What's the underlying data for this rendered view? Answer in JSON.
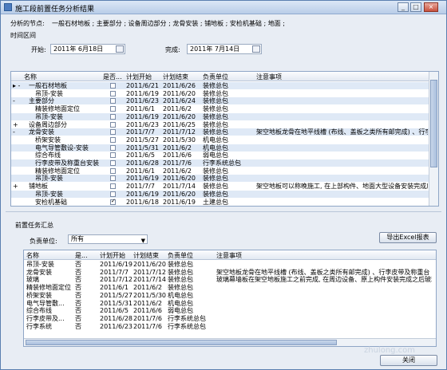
{
  "window": {
    "title": "施工段前置任务分析结果",
    "min": "_",
    "max": "□",
    "close": "×"
  },
  "nodes": {
    "label": "分析的节点:",
    "text": "一般石材地板 ; 主要部分 ; 设备周边部分 ; 龙骨安装 ; 铺地板 ; 安检机基础 ; 地面 ;"
  },
  "interval": {
    "label": "时间区间",
    "start_label": "开始:",
    "start_value": "2011年 6月18日",
    "end_label": "完成:",
    "end_value": "2011年 7月14日"
  },
  "grid": {
    "columns": [
      "名称",
      "是否...",
      "计划开始",
      "计划结束",
      "负责单位",
      "注意事项"
    ],
    "rows": [
      {
        "exp": "▸ -",
        "name": "一般石材地板",
        "chk": false,
        "start": "2011/6/21",
        "end": "2011/6/26",
        "unit": "装修总包",
        "note": ""
      },
      {
        "exp": "",
        "name": "吊顶-安装",
        "chk": false,
        "start": "2011/6/19",
        "end": "2011/6/20",
        "unit": "装修总包",
        "note": ""
      },
      {
        "exp": "-",
        "name": "主要部分",
        "chk": false,
        "start": "2011/6/23",
        "end": "2011/6/24",
        "unit": "装修总包",
        "note": ""
      },
      {
        "exp": "",
        "name": "精装修地面定位",
        "chk": false,
        "start": "2011/6/1",
        "end": "2011/6/2",
        "unit": "装修总包",
        "note": ""
      },
      {
        "exp": "",
        "name": "吊顶-安装",
        "chk": false,
        "start": "2011/6/19",
        "end": "2011/6/20",
        "unit": "装修总包",
        "note": ""
      },
      {
        "exp": "+",
        "name": "设备周边部分",
        "chk": false,
        "start": "2011/6/23",
        "end": "2011/6/25",
        "unit": "装修总包",
        "note": ""
      },
      {
        "exp": "-",
        "name": "龙骨安装",
        "chk": false,
        "start": "2011/7/7",
        "end": "2011/7/12",
        "unit": "装修总包",
        "note": "架空地板龙骨在地平线槽 (布线、盖板之类所有邮完成) 、行李皮"
      },
      {
        "exp": "",
        "name": "桥架安装",
        "chk": false,
        "start": "2011/5/27",
        "end": "2011/5/30",
        "unit": "机电总包",
        "note": ""
      },
      {
        "exp": "",
        "name": "电气导管敷设-安装",
        "chk": false,
        "start": "2011/5/31",
        "end": "2011/6/2",
        "unit": "机电总包",
        "note": ""
      },
      {
        "exp": "",
        "name": "综合布线",
        "chk": false,
        "start": "2011/6/5",
        "end": "2011/6/6",
        "unit": "弱电总包",
        "note": ""
      },
      {
        "exp": "",
        "name": "行李皮带及称重台安装",
        "chk": false,
        "start": "2011/6/28",
        "end": "2011/7/6",
        "unit": "行李系统总包",
        "note": ""
      },
      {
        "exp": "",
        "name": "精装修地面定位",
        "chk": false,
        "start": "2011/6/1",
        "end": "2011/6/2",
        "unit": "装修总包",
        "note": ""
      },
      {
        "exp": "",
        "name": "吊顶-安装",
        "chk": false,
        "start": "2011/6/19",
        "end": "2011/6/20",
        "unit": "装修总包",
        "note": ""
      },
      {
        "exp": "+",
        "name": "铺地板",
        "chk": false,
        "start": "2011/7/7",
        "end": "2011/7/14",
        "unit": "装修总包",
        "note": "架空地板可以称晚施工, 在上部构件、地面大型设备安装完成后安"
      },
      {
        "exp": "",
        "name": "吊顶-安装",
        "chk": false,
        "start": "2011/6/19",
        "end": "2011/6/20",
        "unit": "装修总包",
        "note": ""
      },
      {
        "exp": "",
        "name": "安检机基础",
        "chk": true,
        "start": "2011/6/18",
        "end": "2011/6/19",
        "unit": "土建总包",
        "note": ""
      }
    ]
  },
  "summary": {
    "title": "前置任务汇总",
    "unit_label": "负责单位:",
    "unit_value": "所有",
    "export_label": "导出Excel报表",
    "columns": [
      "名称",
      "是...",
      "计划开始",
      "计划结束",
      "负责单位",
      "注意事项"
    ],
    "rows": [
      {
        "name": "吊顶-安装",
        "flag": "否",
        "start": "2011/6/19",
        "end": "2011/6/20",
        "unit": "装修总包",
        "note": ""
      },
      {
        "name": "龙骨安装",
        "flag": "否",
        "start": "2011/7/7",
        "end": "2011/7/12",
        "unit": "装修总包",
        "note": "架空地板龙骨在地平线槽 (布线、盖板之类所有邮完成) 、行李皮带及称重台"
      },
      {
        "name": "玻璃",
        "flag": "否",
        "start": "2011/7/12",
        "end": "2011/7/14",
        "unit": "装修总包",
        "note": "玻璃幕墙板在架空地板施工之前完成, 在周边设备、原上构件安装完成之后玻璃板安"
      },
      {
        "name": "精装修地面定位",
        "flag": "否",
        "start": "2011/6/1",
        "end": "2011/6/2",
        "unit": "装修总包",
        "note": ""
      },
      {
        "name": "桥架安装",
        "flag": "否",
        "start": "2011/5/27",
        "end": "2011/5/30",
        "unit": "机电总包",
        "note": ""
      },
      {
        "name": "电气导管敷...",
        "flag": "否",
        "start": "2011/5/31",
        "end": "2011/6/2",
        "unit": "机电总包",
        "note": ""
      },
      {
        "name": "综合布线",
        "flag": "否",
        "start": "2011/6/5",
        "end": "2011/6/6",
        "unit": "弱电总包",
        "note": ""
      },
      {
        "name": "行李皮带及...",
        "flag": "否",
        "start": "2011/6/28",
        "end": "2011/7/6",
        "unit": "行李系统总包",
        "note": ""
      },
      {
        "name": "行李系统",
        "flag": "否",
        "start": "2011/6/23",
        "end": "2011/7/6",
        "unit": "行李系统总包",
        "note": ""
      }
    ]
  },
  "footer": {
    "close_label": "关闭"
  },
  "watermark": "zhulong.com"
}
